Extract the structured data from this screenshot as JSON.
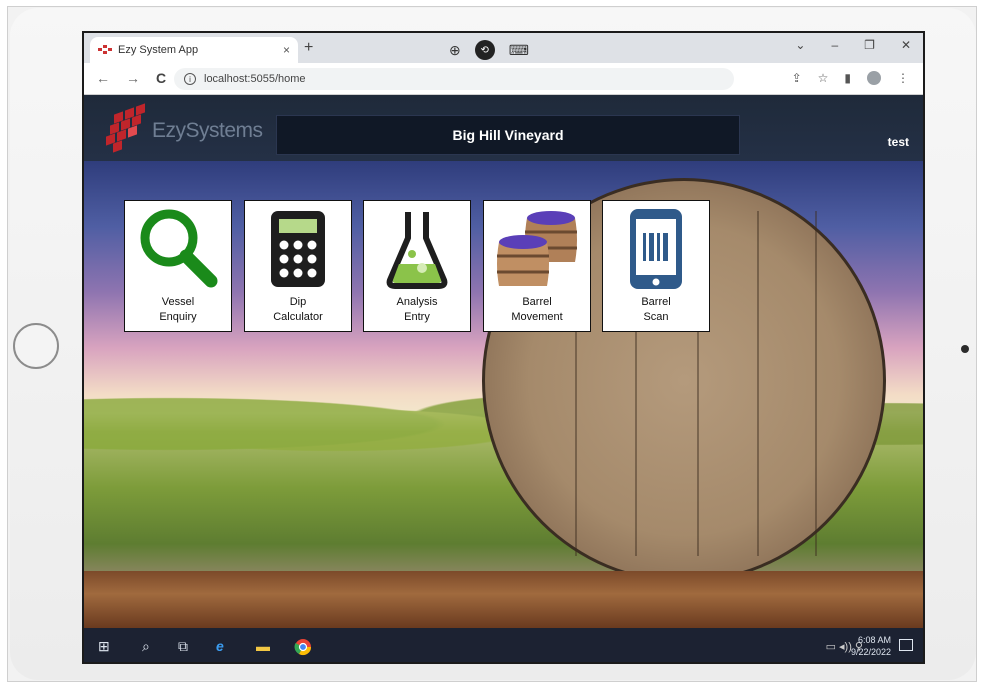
{
  "browser": {
    "tab_title": "Ezy System App",
    "tab_close": "×",
    "new_tab": "+",
    "url": "localhost:5055/home",
    "nav": [
      "←",
      "→",
      "C"
    ],
    "window_controls": [
      "⌄",
      "–",
      "❐",
      "✕"
    ]
  },
  "app": {
    "brand": "EzySystems",
    "title": "Big Hill Vineyard",
    "user": "test"
  },
  "tiles": [
    {
      "label_line1": "Vessel",
      "label_line2": "Enquiry",
      "icon": "magnifier-icon"
    },
    {
      "label_line1": "Dip",
      "label_line2": "Calculator",
      "icon": "calculator-icon"
    },
    {
      "label_line1": "Analysis",
      "label_line2": "Entry",
      "icon": "flask-icon"
    },
    {
      "label_line1": "Barrel",
      "label_line2": "Movement",
      "icon": "barrels-icon"
    },
    {
      "label_line1": "Barrel",
      "label_line2": "Scan",
      "icon": "barcode-phone-icon"
    }
  ],
  "taskbar": {
    "time": "6:08 AM",
    "date": "9/22/2022"
  },
  "colors": {
    "header_bg": "#243046",
    "title_bg": "#101826",
    "magnifier": "#1a8a1a",
    "calculator_screen": "#b6d98a",
    "flask_liquid": "#8bc34a",
    "barcode_phone": "#2f5a8a"
  }
}
